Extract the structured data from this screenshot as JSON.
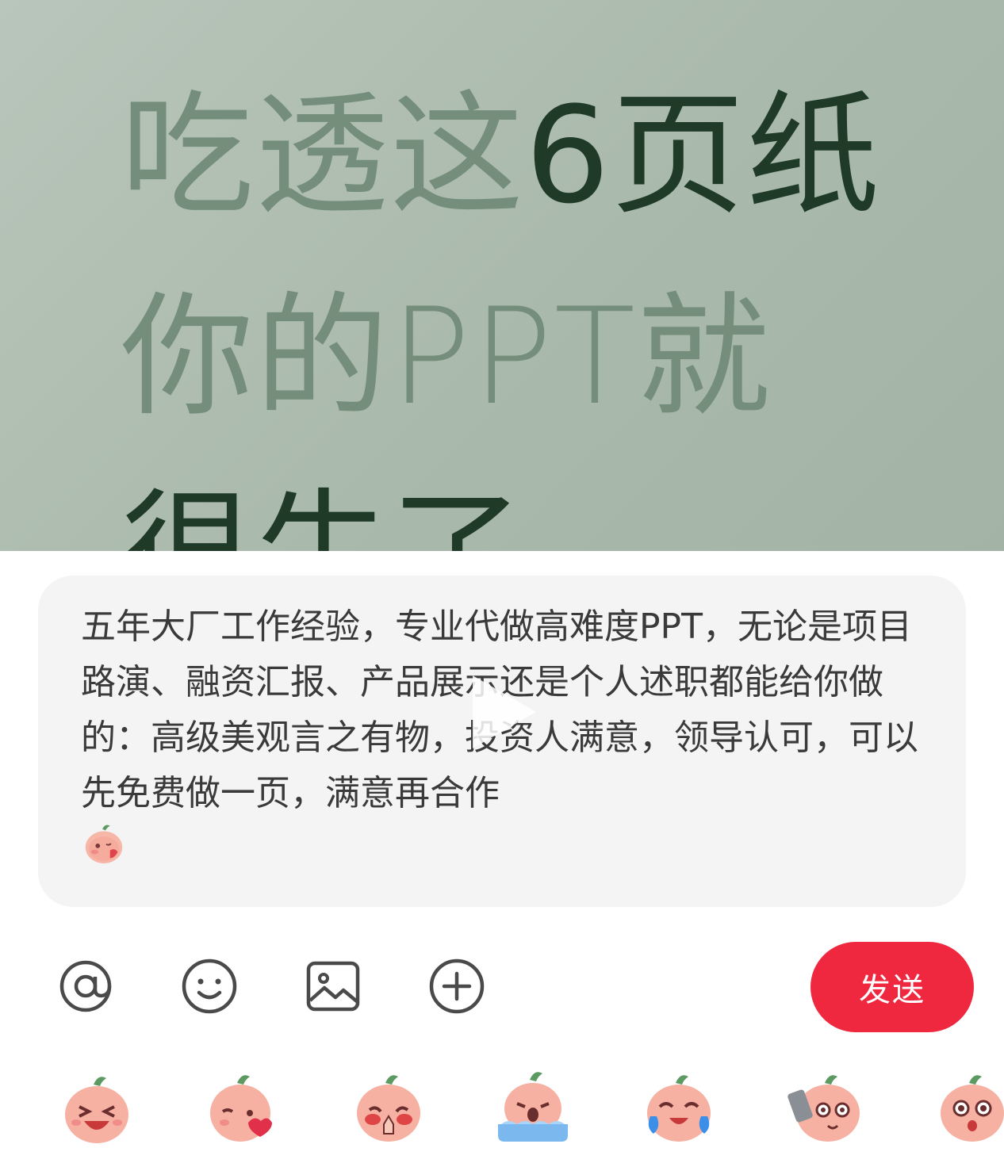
{
  "cover": {
    "line1_light": "吃透这",
    "line1_dark": "6页纸",
    "line2": "你的PPT就",
    "line3": "很牛了"
  },
  "comment": {
    "text": "五年大厂工作经验，专业代做高难度PPT，无论是项目路演、融资汇报、产品展示还是个人述职都能给你做的：高级美观言之有物，投资人满意，领导认可，可以先免费做一页，满意再合作",
    "trailing_emoji": "sticker-peach-shy"
  },
  "toolbar": {
    "mention_icon": "at-icon",
    "emoji_icon": "smiley-icon",
    "image_icon": "image-icon",
    "add_icon": "plus-circle-icon",
    "send_label": "发送"
  },
  "stickers": [
    {
      "name": "sticker-peach-laugh"
    },
    {
      "name": "sticker-peach-heart"
    },
    {
      "name": "sticker-peach-pray"
    },
    {
      "name": "sticker-peach-cry-bath"
    },
    {
      "name": "sticker-peach-tears-of-joy"
    },
    {
      "name": "sticker-peach-phone"
    },
    {
      "name": "sticker-peach-surprised"
    }
  ],
  "colors": {
    "send_button": "#f0283f",
    "cover_bg": "#adbcaf",
    "cover_text_dark": "#1f3a27",
    "cover_text_light": "#748e7b"
  }
}
